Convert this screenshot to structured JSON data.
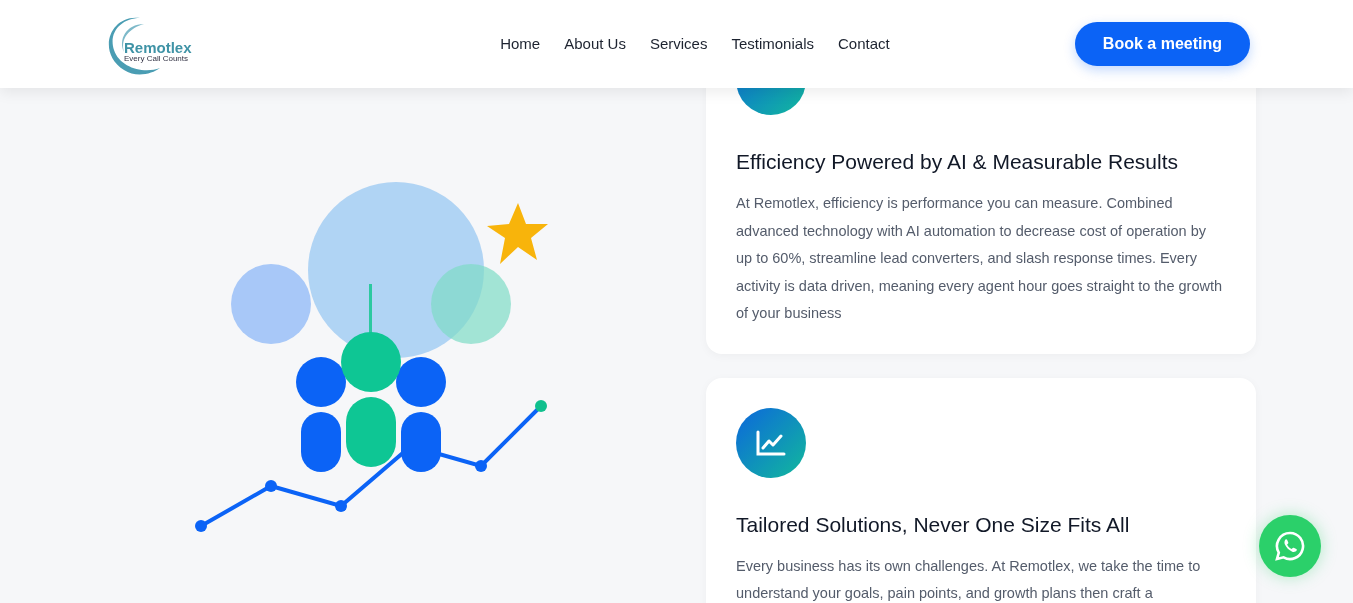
{
  "logo": {
    "name": "Remotlex",
    "tagline": "Every Call Counts"
  },
  "nav": [
    {
      "label": "Home"
    },
    {
      "label": "About Us"
    },
    {
      "label": "Services"
    },
    {
      "label": "Testimonials"
    },
    {
      "label": "Contact"
    }
  ],
  "cta": "Book a meeting",
  "cards": [
    {
      "kind": "plain",
      "title": "Efficiency Powered by AI & Measurable Results",
      "text": "At Remotlex, efficiency is performance you can measure. Combined advanced technology with AI automation to decrease cost of operation by up to 60%, streamline lead converters, and slash response times. Every activity is data driven, meaning every agent hour goes straight to the growth of your business"
    },
    {
      "kind": "chart",
      "title": "Tailored Solutions, Never One Size Fits All",
      "text": "Every business has its own challenges. At Remotlex, we take the time to understand your goals, pain points, and growth plans then craft a"
    }
  ]
}
